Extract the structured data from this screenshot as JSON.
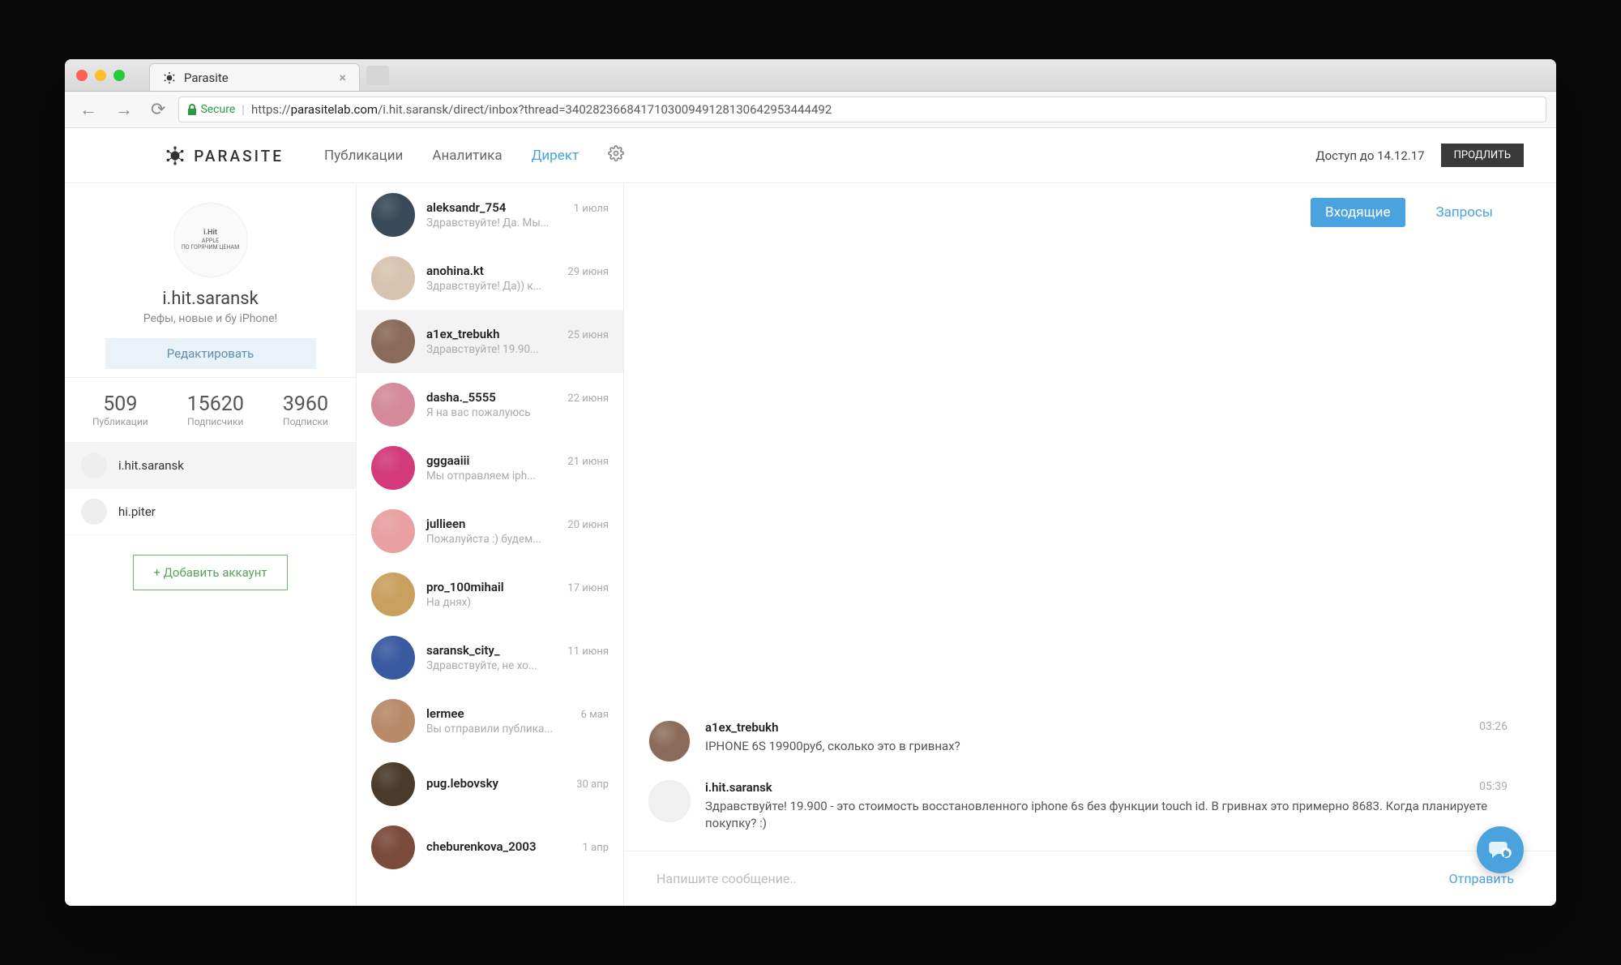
{
  "browser": {
    "tab_title": "Parasite",
    "secure_label": "Secure",
    "url_prefix": "https://",
    "url_host": "parasitelab.com",
    "url_path": "/i.hit.saransk/direct/inbox?thread=340282366841710300949128130642953444492"
  },
  "header": {
    "logo": "PARASITE",
    "nav": {
      "posts": "Публикации",
      "analytics": "Аналитика",
      "direct": "Директ"
    },
    "access_until": "Доступ до 14.12.17",
    "extend": "ПРОДЛИТЬ"
  },
  "profile": {
    "avatar_line1": "i.Hit",
    "avatar_line2": "APPLE",
    "avatar_line3": "ПО ГОРЯЧИМ ЦЕНАМ",
    "username": "i.hit.saransk",
    "bio": "Рефы, новые и бу iPhone!",
    "edit": "Редактировать",
    "stats": {
      "posts_n": "509",
      "posts_l": "Публикации",
      "followers_n": "15620",
      "followers_l": "Подписчики",
      "following_n": "3960",
      "following_l": "Подписки"
    }
  },
  "accounts": [
    {
      "name": "i.hit.saransk",
      "active": true
    },
    {
      "name": "hi.piter",
      "active": false
    }
  ],
  "add_account": "+ Добавить аккаунт",
  "threads": [
    {
      "name": "aleksandr_754",
      "date": "1 июля",
      "preview": "Здравствуйте! Да. Мы...",
      "color": "#3a4a58"
    },
    {
      "name": "anohina.kt",
      "date": "29 июня",
      "preview": "Здравствуйте! Да)) к...",
      "color": "#d7c4b0"
    },
    {
      "name": "a1ex_trebukh",
      "date": "25 июня",
      "preview": "Здравствуйте! 19.90...",
      "color": "#8a6a58",
      "selected": true
    },
    {
      "name": "dasha._5555",
      "date": "22 июня",
      "preview": "Я на вас пожалуюсь",
      "color": "#d48a9a"
    },
    {
      "name": "gggaaiii",
      "date": "21 июня",
      "preview": "Мы отправляем iph...",
      "color": "#d23a7a"
    },
    {
      "name": "jullieen",
      "date": "20 июня",
      "preview": "Пожалуйста :) будем...",
      "color": "#e8a0a0"
    },
    {
      "name": "pro_100mihail",
      "date": "17 июня",
      "preview": "На днях)",
      "color": "#c8a060"
    },
    {
      "name": "saransk_city_",
      "date": "11 июня",
      "preview": "Здравствуйте, не хо...",
      "color": "#3a5aa0"
    },
    {
      "name": "lermee",
      "date": "6 мая",
      "preview": "Вы отправили публика...",
      "color": "#b88a6a"
    },
    {
      "name": "pug.lebovsky",
      "date": "30 апр",
      "preview": "",
      "color": "#4a3a2a"
    },
    {
      "name": "cheburenkova_2003",
      "date": "1 апр",
      "preview": "",
      "color": "#7a4a3a"
    }
  ],
  "chat": {
    "tab_inbox": "Входящие",
    "tab_requests": "Запросы",
    "messages": [
      {
        "author": "a1ex_trebukh",
        "time": "03:26",
        "text": "IPHONE 6S 19900руб, сколько это в гривнах?",
        "color": "#8a6a58"
      },
      {
        "author": "i.hit.saransk",
        "time": "05:39",
        "text": "Здравствуйте! 19.900 - это стоимость восстановленного iphone 6s без функции touch id. В гривнах это примерно 8683. Когда планируете покупку? :)",
        "color": "#f0f0f0"
      }
    ],
    "placeholder": "Напишите сообщение..",
    "send": "Отправить"
  }
}
